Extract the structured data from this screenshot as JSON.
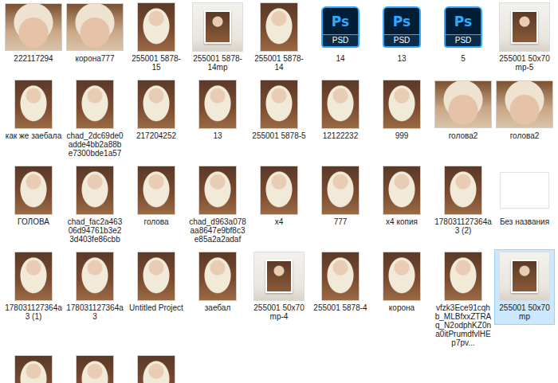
{
  "window": {
    "view": "large-icons"
  },
  "files": [
    {
      "name": "222117294",
      "kind": "square",
      "selected": false
    },
    {
      "name": "корона777",
      "kind": "square",
      "selected": false
    },
    {
      "name": "255001 5878-15",
      "kind": "portrait",
      "selected": false
    },
    {
      "name": "255001 5878-14mp",
      "kind": "mockup",
      "selected": false
    },
    {
      "name": "255001 5878-14",
      "kind": "portrait",
      "selected": false
    },
    {
      "name": "14",
      "kind": "psd",
      "badge": "Ps",
      "badge_label": "PSD",
      "selected": false
    },
    {
      "name": "13",
      "kind": "psd",
      "badge": "Ps",
      "badge_label": "PSD",
      "selected": false
    },
    {
      "name": "5",
      "kind": "psd",
      "badge": "Ps",
      "badge_label": "PSD",
      "selected": false
    },
    {
      "name": "255001 50x70 mp-5",
      "kind": "mockup",
      "selected": false
    },
    {
      "name": "как же заебала",
      "kind": "portrait",
      "selected": false
    },
    {
      "name": "chad_2dc69de0adde4bb2a88be7300bde1a57",
      "kind": "portrait",
      "selected": false
    },
    {
      "name": "217204252",
      "kind": "portrait",
      "selected": false
    },
    {
      "name": "13",
      "kind": "portrait",
      "selected": false
    },
    {
      "name": "255001 5878-5",
      "kind": "portrait",
      "selected": false
    },
    {
      "name": "12122232",
      "kind": "portrait",
      "selected": false
    },
    {
      "name": "999",
      "kind": "portrait",
      "selected": false
    },
    {
      "name": "голова2",
      "kind": "square",
      "selected": false
    },
    {
      "name": "голова2",
      "kind": "square",
      "selected": false
    },
    {
      "name": "ГОЛОВА",
      "kind": "portrait",
      "selected": false
    },
    {
      "name": "chad_fac2a46306d94761b3e23d403fe86cbb",
      "kind": "portrait",
      "selected": false
    },
    {
      "name": "голова",
      "kind": "portrait",
      "selected": false
    },
    {
      "name": "chad_d963a078aa8647e9bf8c3e85a2a2adaf",
      "kind": "portrait",
      "selected": false
    },
    {
      "name": "x4",
      "kind": "portrait",
      "selected": false
    },
    {
      "name": "777",
      "kind": "portrait",
      "selected": false
    },
    {
      "name": "x4 копия",
      "kind": "portrait",
      "selected": false
    },
    {
      "name": "178031127364a3 (2)",
      "kind": "portrait",
      "selected": false
    },
    {
      "name": "Без названия",
      "kind": "blank",
      "selected": false
    },
    {
      "name": "178031127364a3 (1)",
      "kind": "portrait",
      "selected": false
    },
    {
      "name": "178031127364a3",
      "kind": "portrait",
      "selected": false
    },
    {
      "name": "Untitled Project",
      "kind": "portrait",
      "selected": false
    },
    {
      "name": "заебал",
      "kind": "portrait",
      "selected": false
    },
    {
      "name": "255001 50x70 mp-4",
      "kind": "mockup",
      "selected": false
    },
    {
      "name": "255001 5878-4",
      "kind": "portrait",
      "selected": false
    },
    {
      "name": "корона",
      "kind": "portrait",
      "selected": false
    },
    {
      "name": "vfzk3Ece91cqhb_MLBfxxZTRAq_N2odphKZ0na0itPrumdfvlHEp7pv...",
      "kind": "portrait",
      "selected": false
    },
    {
      "name": "255001 50x70 mp",
      "kind": "mockup",
      "selected": true
    },
    {
      "name": "",
      "kind": "portrait",
      "selected": false
    },
    {
      "name": "",
      "kind": "portrait",
      "selected": false
    },
    {
      "name": "",
      "kind": "portrait",
      "selected": false
    }
  ]
}
